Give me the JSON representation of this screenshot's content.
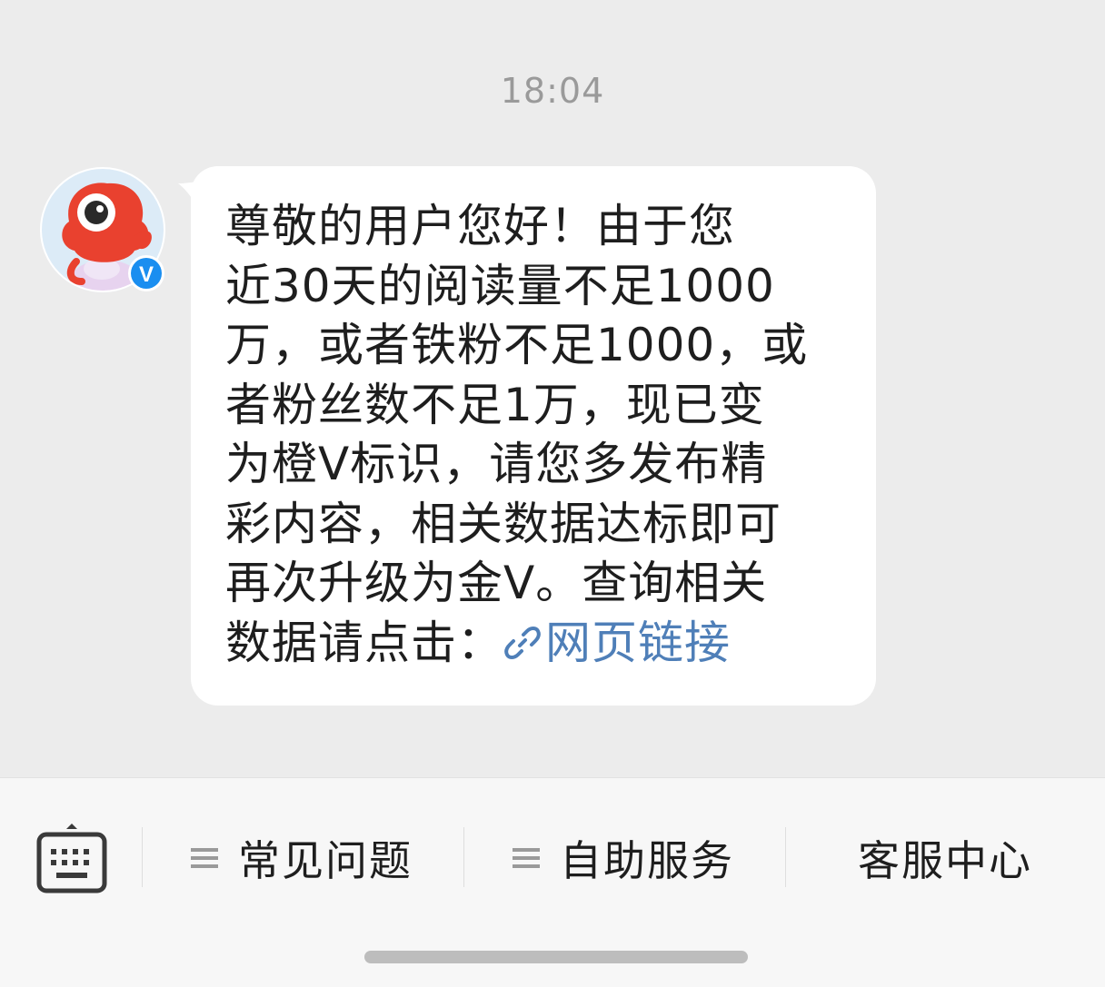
{
  "chat": {
    "timestamp": "18:04",
    "message": {
      "lines": [
        "尊敬的用户您好！由于您",
        "近30天的阅读量不足1000",
        "万，或者铁粉不足1000，或",
        "者粉丝数不足1万，现已变",
        "为橙V标识，请您多发布精",
        "彩内容，相关数据达标即可",
        "再次升级为金V。查询相关"
      ],
      "last_line_prefix": "数据请点击：",
      "link_label": "网页链接",
      "link_icon": "link-icon"
    },
    "sender": {
      "avatar_icon": "weibo-mascot-avatar",
      "badge_icon": "verified-v-badge",
      "badge_text": "V",
      "badge_color": "#1a8ef0"
    }
  },
  "bottom_bar": {
    "keyboard_icon": "keyboard-icon",
    "menu": [
      {
        "label": "常见问题",
        "icon": "menu-lines-icon"
      },
      {
        "label": "自助服务",
        "icon": "menu-lines-icon"
      },
      {
        "label": "客服中心"
      }
    ]
  },
  "colors": {
    "chat_background": "#ececec",
    "bubble": "#ffffff",
    "link": "#4f7fb8",
    "bottom_bar": "#f7f7f7"
  }
}
